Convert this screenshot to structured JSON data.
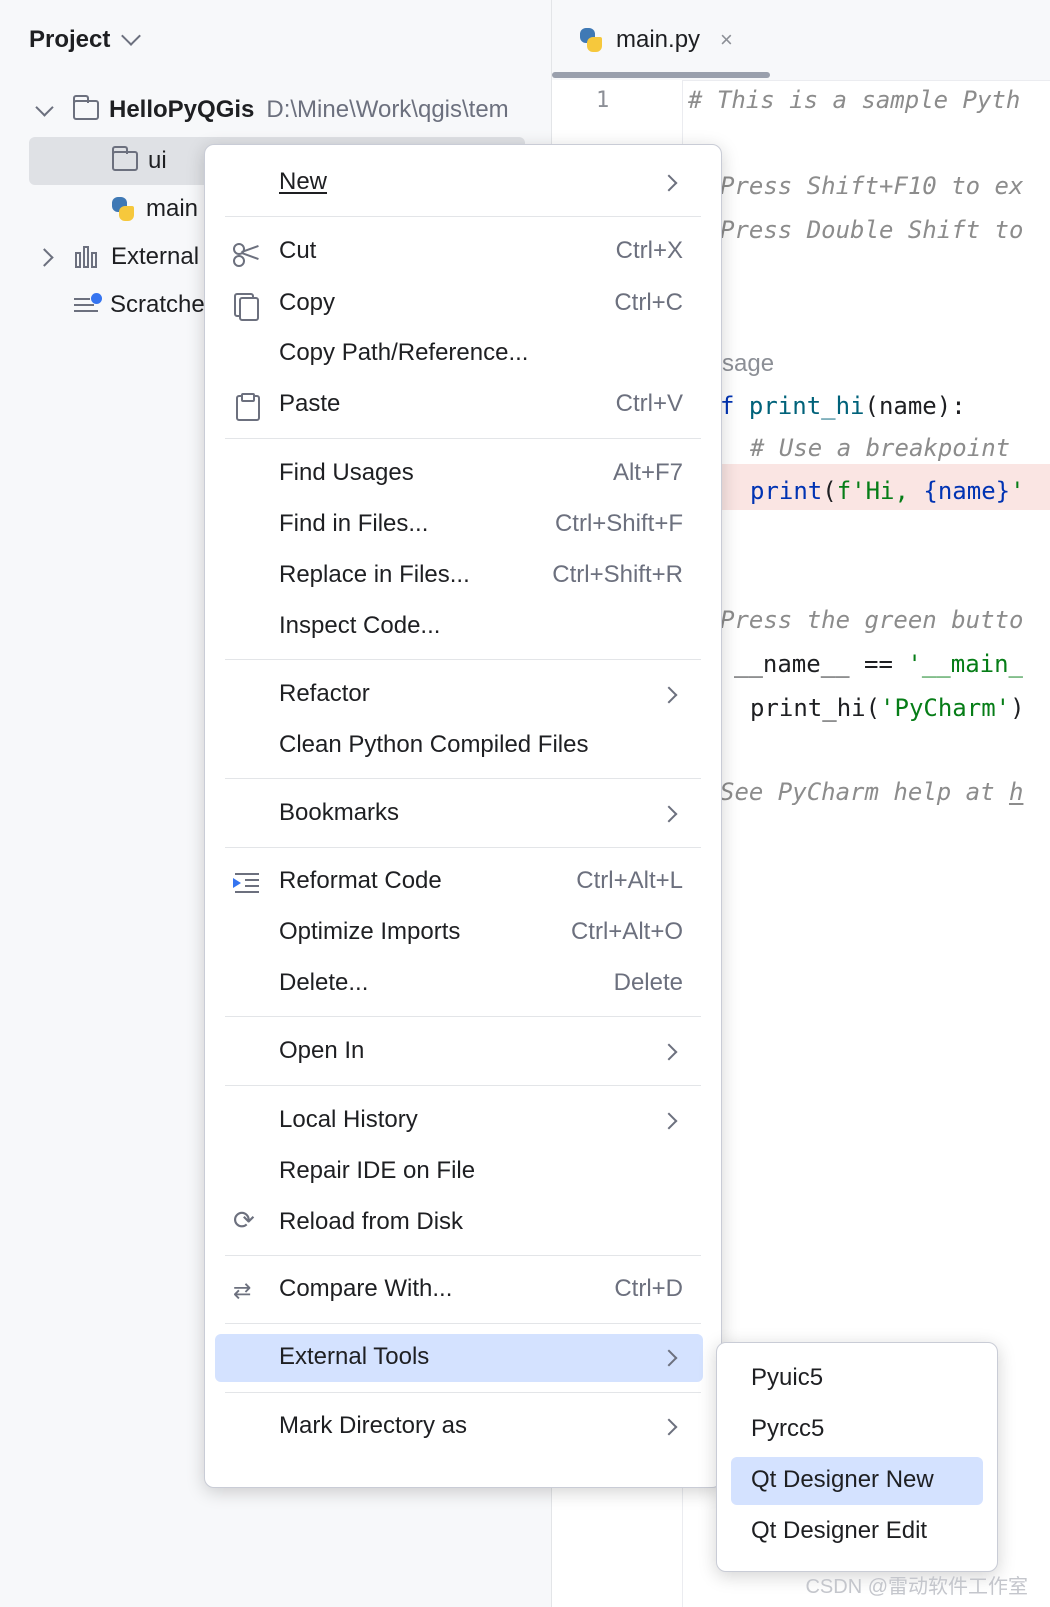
{
  "project": {
    "header_title": "Project",
    "tree": {
      "root_name": "HelloPyQGis",
      "root_path": "D:\\Mine\\Work\\qgis\\tem",
      "ui_folder": "ui",
      "main_file": "main",
      "external": "External",
      "scratches": "Scratche"
    }
  },
  "editor": {
    "tab_label": "main.py",
    "tab_close": "×",
    "line_number": "1",
    "lines": {
      "l1": "# This is a sample Pyth",
      "l2": "Press Shift+F10 to ex",
      "l3": "Press Double Shift to",
      "l4": "sage",
      "l5_kw": "f ",
      "l5_fn": "print_hi",
      "l5_rest": "(name):",
      "l6": "# Use a breakpoint",
      "l7_fn": "print",
      "l7_a": "(",
      "l7_str": "f'Hi, ",
      "l7_b": "{name}",
      "l7_c": "'",
      "l8": "Press the green butto",
      "l9_a": "__name__ == ",
      "l9_str": "'__main_",
      "l10_a": "print_hi(",
      "l10_str": "'PyCharm'",
      "l10_b": ")",
      "l11": "See PyCharm help at ",
      "l11_link": "h"
    }
  },
  "context_menu": {
    "new": {
      "label": "New"
    },
    "cut": {
      "label": "Cut",
      "shortcut": "Ctrl+X"
    },
    "copy": {
      "label": "Copy",
      "shortcut": "Ctrl+C"
    },
    "copy_path": {
      "label": "Copy Path/Reference..."
    },
    "paste": {
      "label": "Paste",
      "shortcut": "Ctrl+V"
    },
    "find_usages": {
      "label": "Find Usages",
      "shortcut": "Alt+F7"
    },
    "find_in_files": {
      "label": "Find in Files...",
      "shortcut": "Ctrl+Shift+F"
    },
    "replace_in_files": {
      "label": "Replace in Files...",
      "shortcut": "Ctrl+Shift+R"
    },
    "inspect_code": {
      "label": "Inspect Code..."
    },
    "refactor": {
      "label": "Refactor"
    },
    "clean_compiled": {
      "label": "Clean Python Compiled Files"
    },
    "bookmarks": {
      "label": "Bookmarks"
    },
    "reformat_code": {
      "label": "Reformat Code",
      "shortcut": "Ctrl+Alt+L"
    },
    "optimize_imports": {
      "label": "Optimize Imports",
      "shortcut": "Ctrl+Alt+O"
    },
    "delete": {
      "label": "Delete...",
      "shortcut": "Delete"
    },
    "open_in": {
      "label": "Open In"
    },
    "local_history": {
      "label": "Local History"
    },
    "repair_ide": {
      "label": "Repair IDE on File"
    },
    "reload_from_disk": {
      "label": "Reload from Disk"
    },
    "compare_with": {
      "label": "Compare With...",
      "shortcut": "Ctrl+D"
    },
    "external_tools": {
      "label": "External Tools"
    },
    "mark_directory": {
      "label": "Mark Directory as"
    }
  },
  "submenu": {
    "items": [
      "Pyuic5",
      "Pyrcc5",
      "Qt Designer New",
      "Qt Designer Edit"
    ],
    "highlighted": "Qt Designer New"
  },
  "watermark": "CSDN @雷动软件工作室",
  "colors": {
    "highlight": "#d4e2ff",
    "accent": "#3574f0",
    "python_blue": "#3f79b5",
    "python_yellow": "#f6c83c"
  }
}
